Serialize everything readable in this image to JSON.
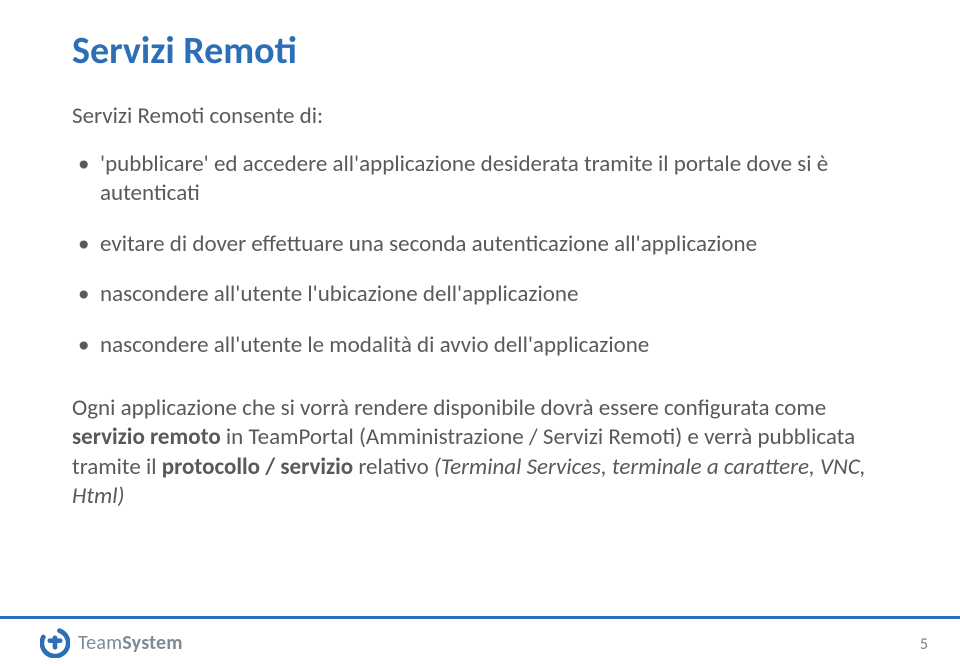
{
  "title": "Servizi Remoti",
  "lead": "Servizi Remoti consente di:",
  "bullets": [
    "'pubblicare' ed accedere all'applicazione desiderata tramite il portale dove si è autenticati",
    "evitare di dover effettuare una seconda autenticazione all'applicazione",
    "nascondere all'utente l'ubicazione dell'applicazione",
    "nascondere all'utente le modalità di avvio dell'applicazione"
  ],
  "paragraph": {
    "pre": "Ogni applicazione che si vorrà rendere disponibile dovrà essere configurata come ",
    "bold1": "servizio remoto",
    "mid1": " in TeamPortal (Amministrazione / Servizi Remoti) e verrà pubblicata tramite il ",
    "bold2": "protocollo / servizio",
    "mid2": " relativo ",
    "italic": "(Terminal Services, terminale a carattere, VNC, Html)"
  },
  "brand": {
    "name_part1": "Team",
    "name_part2": "System"
  },
  "page_number": "5",
  "colors": {
    "accent": "#2c6fb7",
    "body_text": "#5a5a5a"
  }
}
